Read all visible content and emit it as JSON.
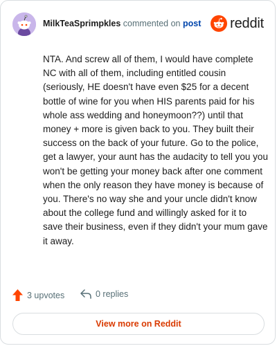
{
  "header": {
    "username": "MilkTeaSprimpkles",
    "action_text": "commented on",
    "post_link": "post",
    "brand": "reddit"
  },
  "comment": {
    "text": "NTA. And screw all of them, I would have complete NC with all of them, including entitled cousin (seriously, HE doesn't have even $25 for a decent bottle of wine for you when HIS parents paid for his whole ass wedding and honeymoon??) until that money + more is given back to you. They built their success on the back of your future. Go to the police, get a lawyer, your aunt has the audacity to tell you you won't be getting your money back after one comment when the only reason they have money is because of you. There's no way she and your uncle didn't know about the college fund and willingly asked for it to save their business, even if they didn't your mum gave it away."
  },
  "actions": {
    "upvotes": "3 upvotes",
    "replies": "0 replies"
  },
  "footer": {
    "view_more": "View more on Reddit"
  },
  "colors": {
    "brand_orange": "#ff4500",
    "link_blue": "#0045ac",
    "muted": "#576f76"
  },
  "icons": {
    "avatar": "snoo-avatar-icon",
    "logo": "reddit-logo-icon",
    "upvote": "upvote-arrow-icon",
    "reply": "reply-arrow-icon"
  }
}
